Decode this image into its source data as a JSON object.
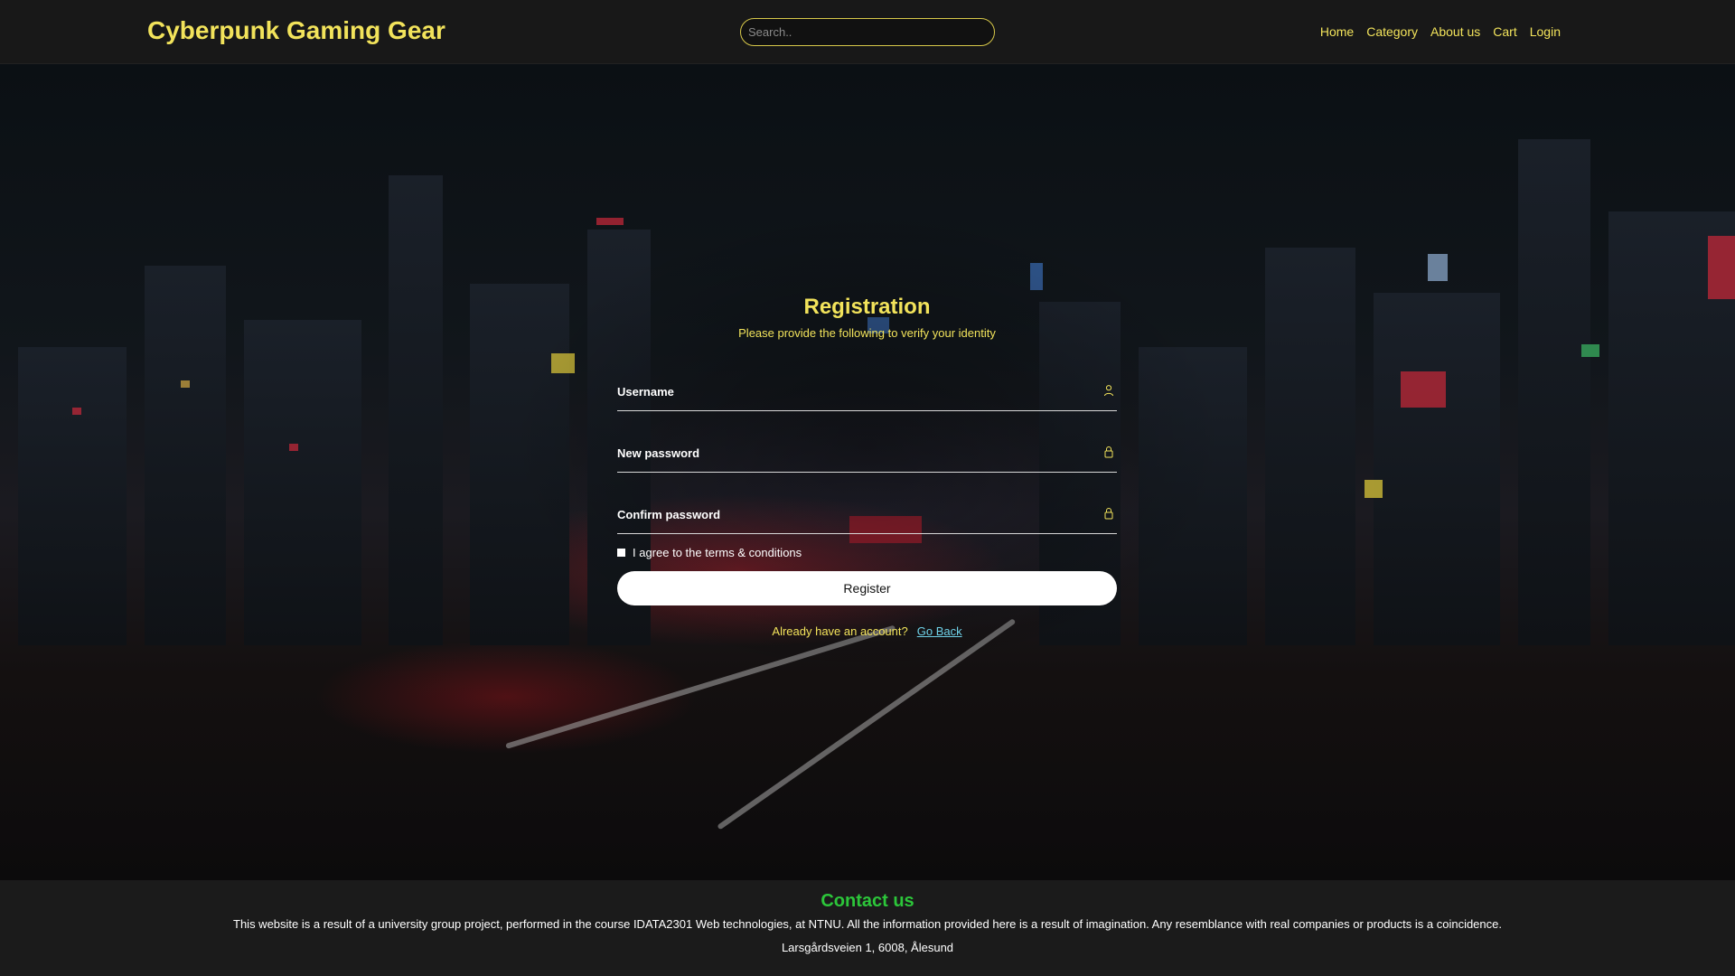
{
  "header": {
    "brand": "Cyberpunk Gaming Gear",
    "search_placeholder": "Search..",
    "nav": [
      "Home",
      "Category",
      "About us",
      "Cart",
      "Login"
    ]
  },
  "registration": {
    "title": "Registration",
    "subtitle": "Please provide the following to verify your identity",
    "fields": [
      {
        "label": "Username",
        "icon": "user-icon"
      },
      {
        "label": "New password",
        "icon": "lock-icon"
      },
      {
        "label": "Confirm password",
        "icon": "lock-icon"
      }
    ],
    "terms_label": "I agree to the terms & conditions",
    "register_label": "Register",
    "already_text": "Already have an account?",
    "go_back_label": "Go Back"
  },
  "footer": {
    "heading": "Contact us",
    "description": "This website is a result of a university group project, performed in the course IDATA2301 Web technologies, at NTNU. All the information provided here is a result of imagination. Any resemblance with real companies or products is a coincidence.",
    "address": "Larsgårdsveien 1, 6008, Ålesund"
  },
  "colors": {
    "accent": "#f2e35b",
    "link": "#6fd1e8",
    "contact_heading": "#2cc63a",
    "header_bg": "#181818",
    "footer_bg": "#1b1b1b"
  }
}
